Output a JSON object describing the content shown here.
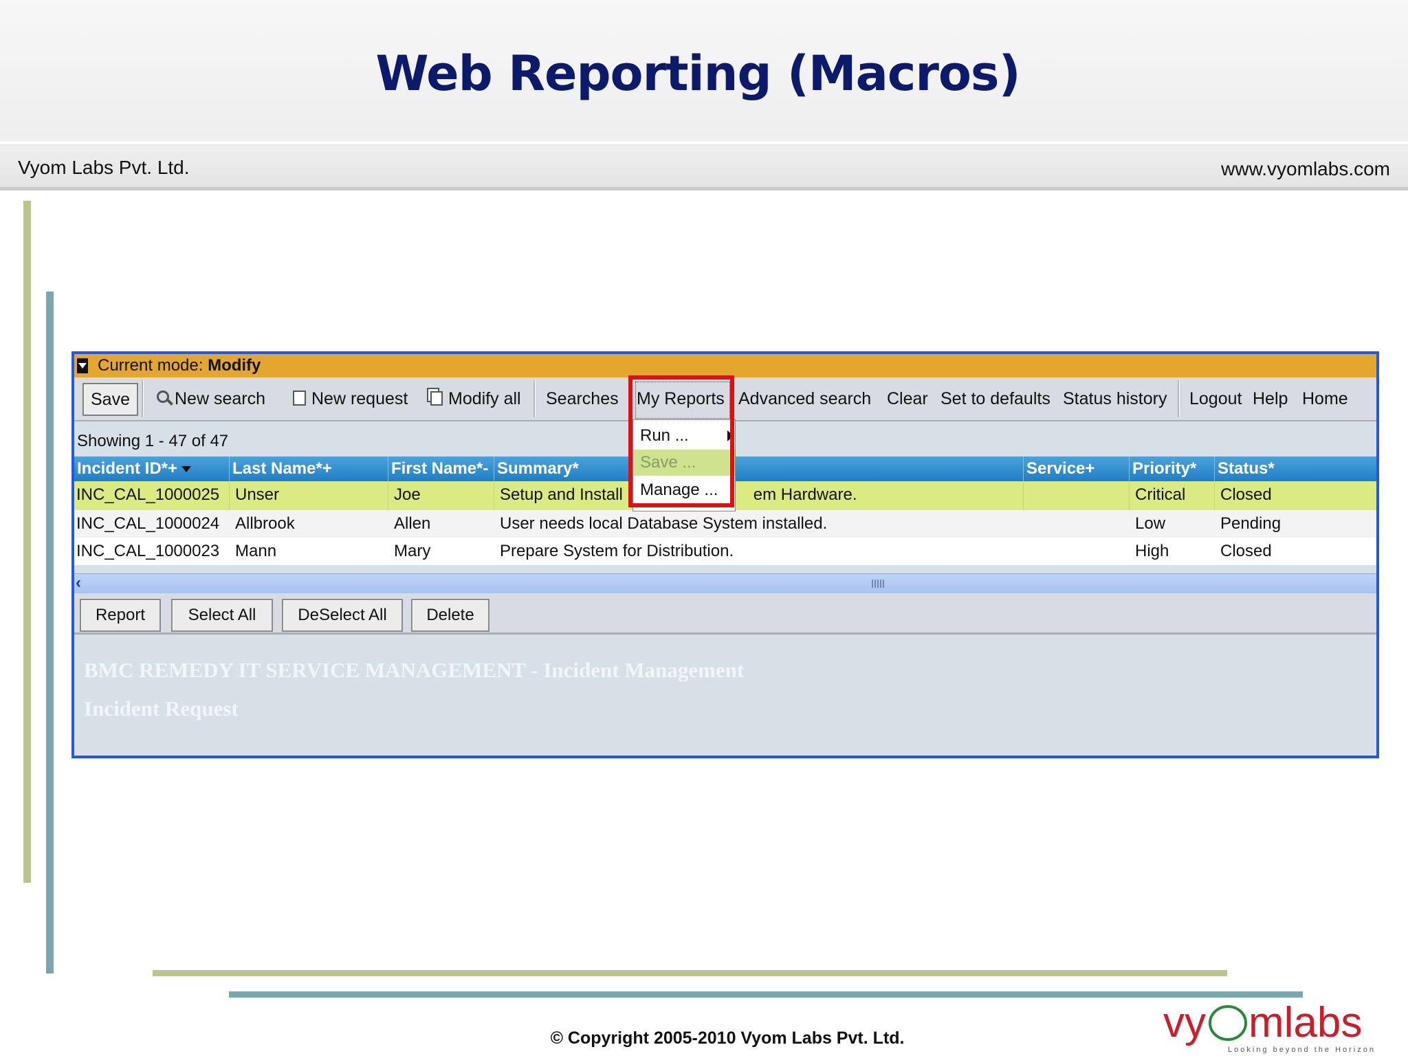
{
  "slide": {
    "title": "Web Reporting (Macros)",
    "company": "Vyom Labs Pvt. Ltd.",
    "website": "www.vyomlabs.com",
    "copyright": "© Copyright 2005-2010 Vyom Labs Pvt. Ltd.",
    "logo": {
      "brand": "vyomlabs",
      "tagline": "Looking beyond the Horizon"
    }
  },
  "app": {
    "mode": {
      "label": "Current mode:",
      "value": "Modify"
    },
    "toolbar": {
      "save": "Save",
      "new_search": "New search",
      "new_request": "New request",
      "modify_all": "Modify all",
      "searches": "Searches",
      "my_reports": "My Reports",
      "advanced_search": "Advanced search",
      "clear": "Clear",
      "set_to_defaults": "Set to defaults",
      "status_history": "Status history",
      "logout": "Logout",
      "help": "Help",
      "home": "Home"
    },
    "my_reports_menu": {
      "run": "Run ...",
      "save": "Save ...",
      "manage": "Manage ..."
    },
    "showing": "Showing 1 - 47 of 47",
    "table": {
      "columns": [
        "Incident ID*+",
        "Last Name*+",
        "First Name*-",
        "Summary*",
        "Service+",
        "Priority*",
        "Status*"
      ],
      "rows": [
        [
          "INC_CAL_1000025",
          "Unser",
          "Joe",
          "Setup and Install",
          "em Hardware.",
          "",
          "Critical",
          "Closed"
        ],
        [
          "INC_CAL_1000024",
          "Allbrook",
          "Allen",
          "User needs local Database System installed.",
          "",
          "Low",
          "Pending"
        ],
        [
          "INC_CAL_1000023",
          "Mann",
          "Mary",
          "Prepare System for Distribution.",
          "",
          "High",
          "Closed"
        ]
      ]
    },
    "actions": {
      "report": "Report",
      "select_all": "Select All",
      "deselect_all": "DeSelect All",
      "delete": "Delete"
    },
    "brand_line1": "BMC REMEDY IT SERVICE MANAGEMENT - Incident Management",
    "brand_line2": "Incident Request"
  },
  "colors": {
    "title": "#0b1a6b",
    "mode_bar": "#e3a62e",
    "grid_header": "#1f7fc4",
    "selected_row": "#dbeb81",
    "highlight_box": "#e01010",
    "frame": "#2458e0"
  }
}
